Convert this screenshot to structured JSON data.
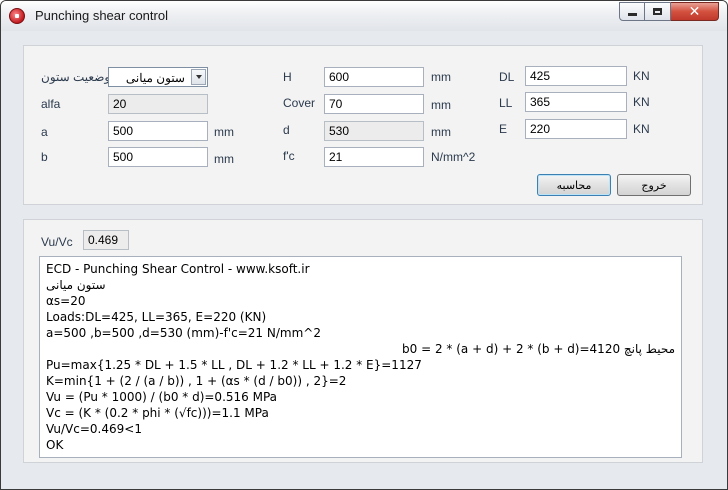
{
  "window": {
    "title": "Punching shear control",
    "close_glyph": "✕"
  },
  "form": {
    "column_position": {
      "label": "وضعیت ستون",
      "value": "ستون میانی"
    },
    "alfa": {
      "label": "alfa",
      "value": "20"
    },
    "a": {
      "label": "a",
      "value": "500",
      "unit": "mm"
    },
    "b": {
      "label": "b",
      "value": "500",
      "unit": "mm"
    },
    "H": {
      "label": "H",
      "value": "600",
      "unit": "mm"
    },
    "cover": {
      "label": "Cover",
      "value": "70",
      "unit": "mm"
    },
    "d": {
      "label": "d",
      "value": "530",
      "unit": "mm"
    },
    "fc": {
      "label": "f'c",
      "value": "21",
      "unit": "N/mm^2"
    },
    "DL": {
      "label": "DL",
      "value": "425",
      "unit": "KN"
    },
    "LL": {
      "label": "LL",
      "value": "365",
      "unit": "KN"
    },
    "E": {
      "label": "E",
      "value": "220",
      "unit": "KN"
    }
  },
  "buttons": {
    "calculate": "محاسبه",
    "exit": "خروج"
  },
  "result": {
    "label": "Vu/Vc",
    "value": "0.469"
  },
  "output_lines": [
    "ECD - Punching Shear Control - www.ksoft.ir",
    "ستون میانی",
    "αs=20",
    "Loads:DL=425, LL=365, E=220 (KN)",
    "a=500 ,b=500 ,d=530 (mm)-f'c=21 N/mm^2",
    "محیط پانچ b0 = 2 * (a + d) + 2 * (b + d)=4120",
    "Pu=max{1.25 * DL + 1.5 * LL , DL + 1.2 * LL + 1.2 * E}=1127",
    "K=min{1 + (2 / (a / b)) , 1 + (αs * (d / b0)) , 2}=2",
    "Vu = (Pu * 1000) / (b0 * d)=0.516 MPa",
    "Vc = (K * (0.2 * phi * (√fc)))=1.1 MPa",
    "Vu/Vc=0.469<1",
    "OK"
  ],
  "icons": {
    "app": "app-icon",
    "minimize": "minimize-icon",
    "maximize": "maximize-icon",
    "close": "close-icon",
    "dropdown": "chevron-down-icon"
  },
  "colors": {
    "title_bar": "#e1e4e9",
    "close_button": "#c0392b",
    "label_text": "#2b3a4d"
  }
}
